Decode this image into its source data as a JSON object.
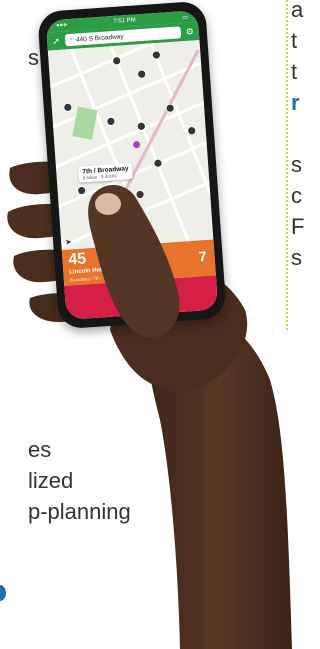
{
  "background_text": {
    "right_lines": [
      "a",
      "t",
      "t",
      "r",
      "s",
      "c",
      "F",
      "s"
    ],
    "left_top": "s",
    "left_bottom": [
      "es",
      "lized",
      "p-planning"
    ]
  },
  "phone": {
    "status_time": "7:51 PM",
    "search_text": "440 S Broadway",
    "callout_title": "7th / Broadway",
    "callout_sub": "8 bikes · 8 docks",
    "station_number": "45",
    "station_name": "Lincoln Heights",
    "station_sub": "Broadway / 7th",
    "count_right": "7"
  },
  "colors": {
    "app_green": "#2a9d45",
    "panel_orange": "#e8732b",
    "panel_red": "#d61f45",
    "accent_blue": "#1b73a8",
    "dotted_line": "#f1c232"
  }
}
